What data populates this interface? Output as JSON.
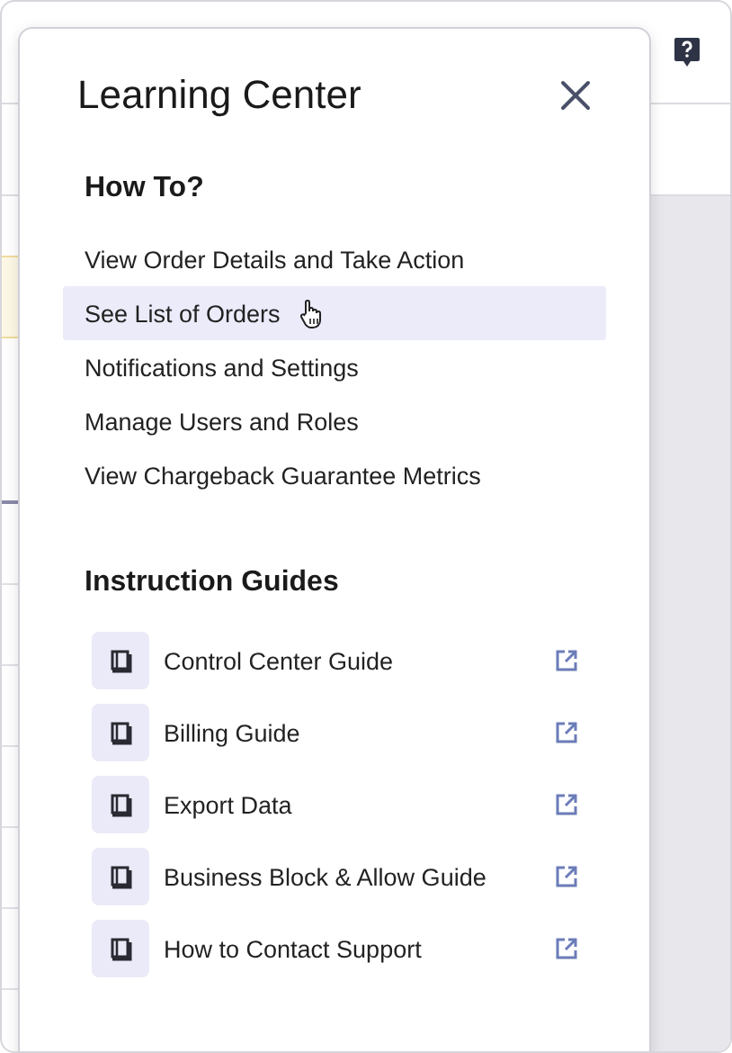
{
  "panel": {
    "title": "Learning Center",
    "how_to": {
      "heading": "How To?",
      "items": [
        {
          "label": "View Order Details and Take Action",
          "selected": false
        },
        {
          "label": "See List of Orders",
          "selected": true
        },
        {
          "label": "Notifications and Settings",
          "selected": false
        },
        {
          "label": "Manage Users and Roles",
          "selected": false
        },
        {
          "label": "View Chargeback Guarantee Metrics",
          "selected": false
        }
      ]
    },
    "guides": {
      "heading": "Instruction Guides",
      "items": [
        {
          "label": "Control Center Guide"
        },
        {
          "label": "Billing Guide"
        },
        {
          "label": "Export Data"
        },
        {
          "label": "Business Block & Allow Guide"
        },
        {
          "label": "How to Contact Support"
        }
      ]
    }
  }
}
